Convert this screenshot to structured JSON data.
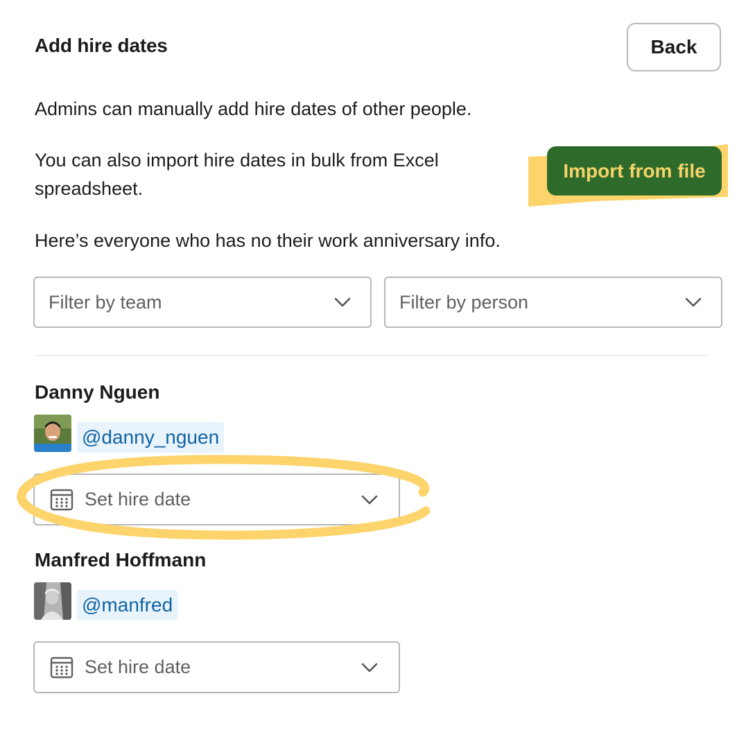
{
  "header": {
    "title": "Add hire dates",
    "back_label": "Back"
  },
  "intro": {
    "line1": "Admins can manually add hire dates of other people.",
    "line2": "You can also import hire dates in bulk from Excel spreadsheet.",
    "line3": "Here’s everyone who has no their work anniversary info.",
    "import_label": "Import from file"
  },
  "filters": {
    "team_placeholder": "Filter by team",
    "person_placeholder": "Filter by person"
  },
  "people": [
    {
      "name": "Danny Nguen",
      "handle": "@danny_nguen",
      "date_placeholder": "Set hire date"
    },
    {
      "name": "Manfred Hoffmann",
      "handle": "@manfred",
      "date_placeholder": "Set hire date"
    }
  ],
  "colors": {
    "import_button_bg": "#2e6b2b",
    "import_button_text": "#f5d36a",
    "highlight": "#fdd46b",
    "mention_text": "#1264a3",
    "mention_bg": "#e8f3fb"
  },
  "icons": {
    "calendar": "calendar-icon",
    "chevron": "chevron-down-icon"
  }
}
